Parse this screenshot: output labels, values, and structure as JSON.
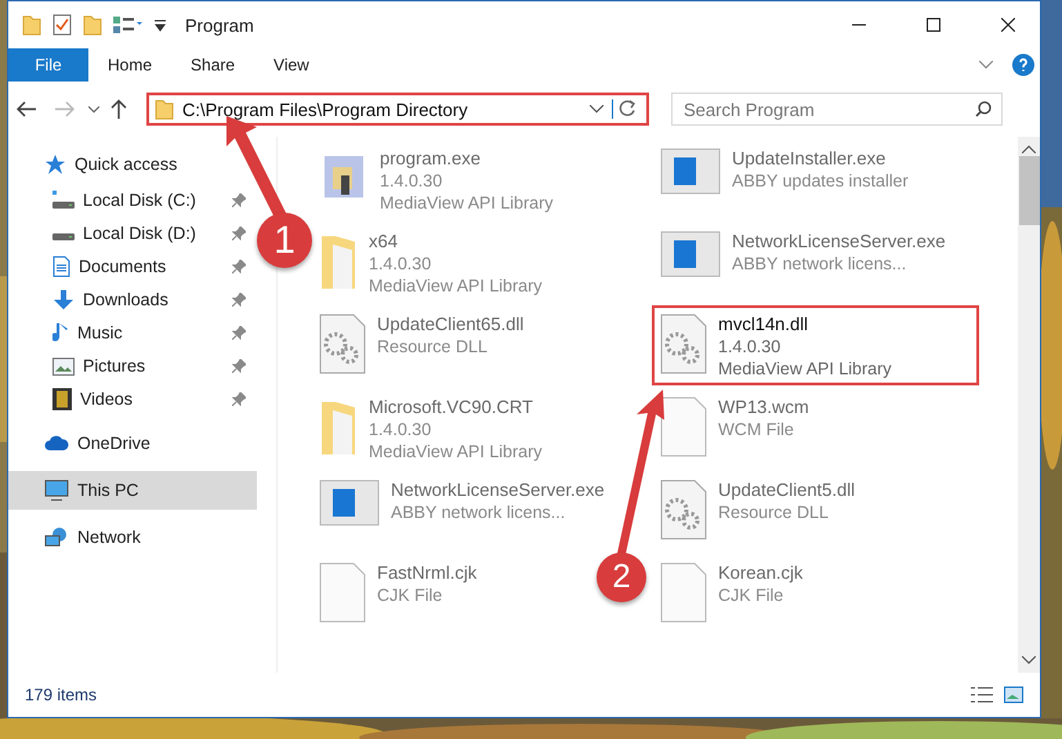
{
  "window": {
    "title": "Program"
  },
  "ribbon_tabs": [
    {
      "label": "File",
      "kind": "file"
    },
    {
      "label": "Home",
      "kind": "tab"
    },
    {
      "label": "Share",
      "kind": "tab"
    },
    {
      "label": "View",
      "kind": "tab"
    }
  ],
  "address_bar": {
    "path": "C:\\Program Files\\Program Directory",
    "highlighted": true
  },
  "search": {
    "placeholder": "Search Program"
  },
  "sidebar": {
    "items": [
      {
        "label": "Quick access",
        "selected": false,
        "children": [
          {
            "label": "Local Disk (C:)",
            "pinned": true
          },
          {
            "label": "Local Disk (D:)",
            "pinned": true
          },
          {
            "label": "Documents",
            "pinned": true
          },
          {
            "label": "Downloads",
            "pinned": true
          },
          {
            "label": "Music",
            "pinned": true
          },
          {
            "label": "Pictures",
            "pinned": true
          },
          {
            "label": "Videos",
            "pinned": true
          }
        ]
      },
      {
        "label": "OneDrive",
        "selected": false
      },
      {
        "label": "This PC",
        "selected": true
      },
      {
        "label": "Network",
        "selected": false
      }
    ]
  },
  "files": [
    {
      "name": "program.exe",
      "details": [
        "1.4.0.30",
        "MediaView API Library"
      ],
      "kind": "app",
      "blurred": true,
      "highlighted": false
    },
    {
      "name": "UpdateInstaller.exe",
      "details": [
        "ABBY updates installer"
      ],
      "kind": "exe",
      "blurred": true,
      "highlighted": false
    },
    {
      "name": "x64",
      "details": [
        "1.4.0.30",
        "MediaView API Library"
      ],
      "kind": "folder",
      "blurred": true,
      "highlighted": false
    },
    {
      "name": "NetworkLicenseServer.exe",
      "details": [
        "ABBY network licens..."
      ],
      "kind": "exe",
      "blurred": true,
      "highlighted": false
    },
    {
      "name": "UpdateClient65.dll",
      "details": [
        "Resource DLL"
      ],
      "kind": "dll",
      "blurred": true,
      "highlighted": false
    },
    {
      "name": "mvcl14n.dll",
      "details": [
        "1.4.0.30",
        "MediaView API Library"
      ],
      "kind": "dll",
      "blurred": false,
      "highlighted": true
    },
    {
      "name": "Microsoft.VC90.CRT",
      "details": [
        "1.4.0.30",
        "MediaView API Library"
      ],
      "kind": "folder",
      "blurred": true,
      "highlighted": false
    },
    {
      "name": "WP13.wcm",
      "details": [
        "WCM File"
      ],
      "kind": "blank",
      "blurred": true,
      "highlighted": false
    },
    {
      "name": "NetworkLicenseServer.exe",
      "details": [
        "ABBY network licens..."
      ],
      "kind": "exe",
      "blurred": true,
      "highlighted": false
    },
    {
      "name": "UpdateClient5.dll",
      "details": [
        "Resource DLL"
      ],
      "kind": "dll",
      "blurred": true,
      "highlighted": false
    },
    {
      "name": "FastNrml.cjk",
      "details": [
        "CJK File"
      ],
      "kind": "blank",
      "blurred": true,
      "highlighted": false
    },
    {
      "name": "Korean.cjk",
      "details": [
        "CJK File"
      ],
      "kind": "blank",
      "blurred": true,
      "highlighted": false
    }
  ],
  "annotations": [
    {
      "number": "1"
    },
    {
      "number": "2"
    }
  ],
  "status_bar": {
    "item_count": "179 items"
  }
}
